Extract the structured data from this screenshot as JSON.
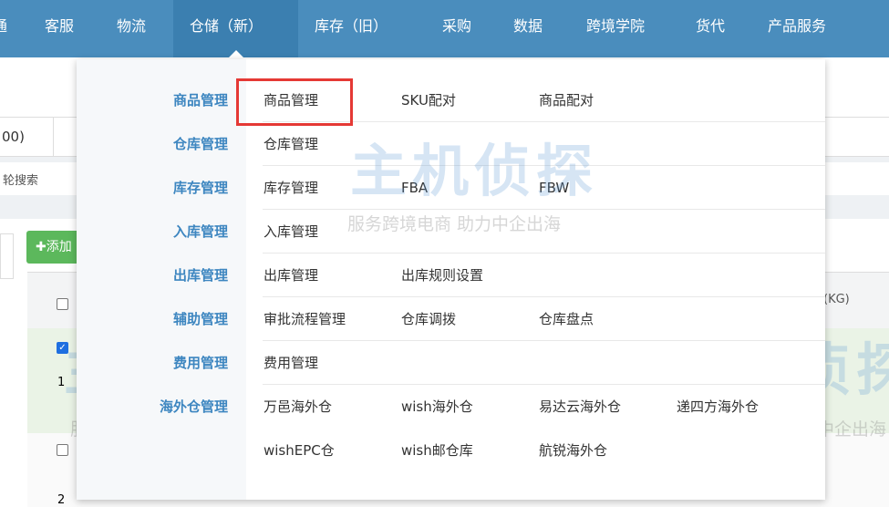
{
  "nav": {
    "items": [
      "通",
      "客服",
      "物流",
      "仓储（新）",
      "库存（旧）",
      "采购",
      "数据",
      "跨境学院",
      "货代",
      "产品服务"
    ],
    "active": "仓储（新）"
  },
  "background": {
    "filter_value": "00)",
    "search_placeholder": "轮搜索",
    "add_button": "添加",
    "column_weight": "(KG)",
    "row_numbers": [
      "1",
      "2"
    ]
  },
  "menu": {
    "rows": [
      {
        "category": "商品管理",
        "links": [
          "商品管理",
          "SKU配对",
          "商品配对"
        ]
      },
      {
        "category": "仓库管理",
        "links": [
          "仓库管理"
        ]
      },
      {
        "category": "库存管理",
        "links": [
          "库存管理",
          "FBA",
          "FBW"
        ]
      },
      {
        "category": "入库管理",
        "links": [
          "入库管理"
        ]
      },
      {
        "category": "出库管理",
        "links": [
          "出库管理",
          "出库规则设置"
        ]
      },
      {
        "category": "辅助管理",
        "links": [
          "审批流程管理",
          "仓库调拨",
          "仓库盘点"
        ]
      },
      {
        "category": "费用管理",
        "links": [
          "费用管理"
        ]
      },
      {
        "category": "海外仓管理",
        "links": [
          "万邑海外仓",
          "wish海外仓",
          "易达云海外仓",
          "递四方海外仓"
        ]
      },
      {
        "category": "",
        "links": [
          "wishEPC仓",
          "wish邮仓库",
          "航锐海外仓"
        ]
      }
    ],
    "highlighted": "商品管理"
  },
  "watermark": {
    "logo": "主机侦探",
    "slogan": "服务跨境电商 助力中企出海"
  },
  "colors": {
    "nav": "#4a8dbd",
    "accent": "#3d86c0",
    "highlight": "#e53935",
    "add_button": "#5cb85c"
  }
}
